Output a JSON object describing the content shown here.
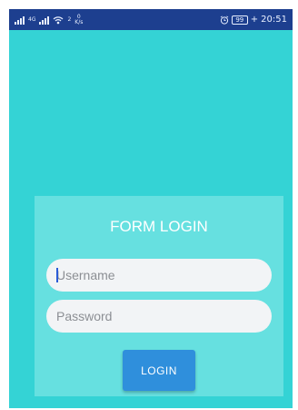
{
  "status_bar": {
    "signal_text": "4G",
    "wifi_superscript": "2",
    "net_speed_value": "0",
    "net_speed_unit": "K/s",
    "battery": "99",
    "charging_symbol": "+",
    "time": "20:51",
    "background_color": "#1d3f8f"
  },
  "colors": {
    "screen_background": "#34d3d5",
    "card_background": "#66e0e0",
    "button_background": "#2f8fdc",
    "input_background": "#f2f4f6"
  },
  "form": {
    "title": "FORM LOGIN",
    "username_placeholder": "Username",
    "password_placeholder": "Password",
    "login_label": "LOGIN"
  }
}
